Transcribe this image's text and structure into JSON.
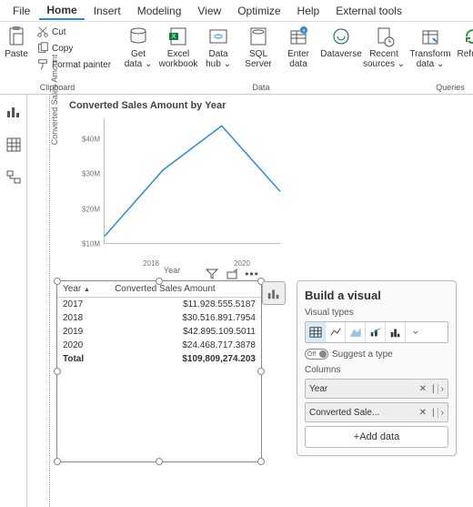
{
  "menu": {
    "file": "File",
    "home": "Home",
    "insert": "Insert",
    "modeling": "Modeling",
    "view": "View",
    "optimize": "Optimize",
    "help": "Help",
    "external": "External tools"
  },
  "ribbon": {
    "clipboard": {
      "paste": "Paste",
      "cut": "Cut",
      "copy": "Copy",
      "format_painter": "Format painter",
      "group": "Clipboard"
    },
    "data": {
      "get_data": "Get\ndata ⌄",
      "excel": "Excel\nworkbook",
      "data_hub": "Data\nhub ⌄",
      "sql": "SQL\nServer",
      "enter": "Enter\ndata",
      "dataverse": "Dataverse",
      "recent": "Recent\nsources ⌄",
      "group": "Data"
    },
    "queries": {
      "transform": "Transform\ndata ⌄",
      "refresh": "Refresh",
      "group": "Queries"
    }
  },
  "chart_data": {
    "type": "line",
    "title": "Converted Sales Amount by Year",
    "xlabel": "Year",
    "ylabel": "Converted Sales Amount",
    "categories": [
      "2017",
      "2018",
      "2019",
      "2020"
    ],
    "values": [
      11928555.5187,
      30516891.7954,
      42895109.5011,
      24468717.3878
    ],
    "ylim": [
      10000000,
      45000000
    ],
    "y_ticks_labels": [
      "$10M",
      "$20M",
      "$30M",
      "$40M"
    ],
    "y_ticks_values": [
      10000000,
      20000000,
      30000000,
      40000000
    ],
    "x_tick_labels": [
      "2018",
      "2020"
    ]
  },
  "table": {
    "col_year": "Year",
    "col_amount": "Converted Sales Amount",
    "rows": [
      {
        "year": "2017",
        "amount": "$11.928.555.5187"
      },
      {
        "year": "2018",
        "amount": "$30.516.891.7954"
      },
      {
        "year": "2019",
        "amount": "$42.895.109.5011"
      },
      {
        "year": "2020",
        "amount": "$24.468.717.3878"
      }
    ],
    "total_label": "Total",
    "total_value": "$109,809,274.203"
  },
  "panel": {
    "title": "Build a visual",
    "visual_types": "Visual types",
    "suggest": "Suggest a type",
    "toggle": "Off",
    "columns": "Columns",
    "field1": "Year",
    "field2": "Converted Sale...",
    "add": "+Add data"
  }
}
